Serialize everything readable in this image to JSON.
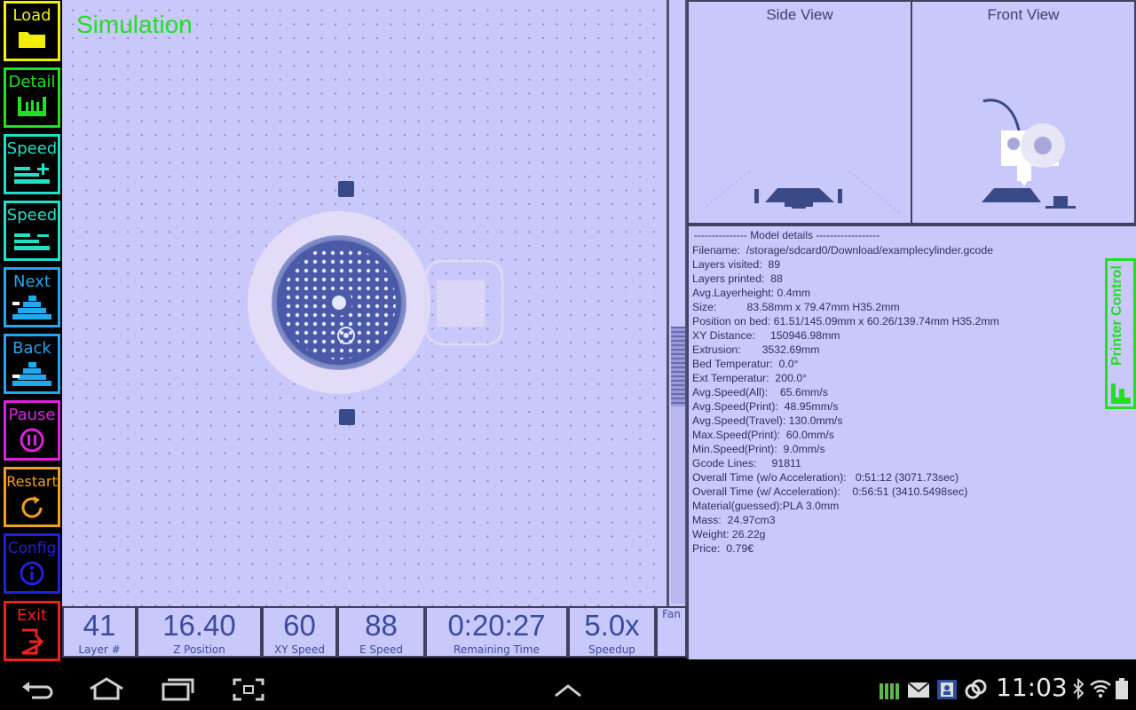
{
  "sidebar": {
    "buttons": [
      {
        "label": "Load",
        "color": "#f0f000",
        "icon": "folder-icon"
      },
      {
        "label": "Detail",
        "color": "#20e020",
        "icon": "detail-icon"
      },
      {
        "label": "Speed",
        "color": "#20e0c8",
        "icon": "speed-up-icon"
      },
      {
        "label": "Speed",
        "color": "#20e0c8",
        "icon": "speed-down-icon"
      },
      {
        "label": "Next",
        "color": "#20a8f0",
        "icon": "next-layer-icon"
      },
      {
        "label": "Back",
        "color": "#20a8f0",
        "icon": "back-layer-icon"
      },
      {
        "label": "Pause",
        "color": "#e020e0",
        "icon": "pause-icon"
      },
      {
        "label": "Restart",
        "color": "#f0a020",
        "icon": "restart-icon"
      },
      {
        "label": "Config",
        "color": "#2020e0",
        "icon": "info-icon"
      },
      {
        "label": "Exit",
        "color": "#f02020",
        "icon": "exit-icon"
      }
    ]
  },
  "canvas": {
    "title": "Simulation"
  },
  "stats": [
    {
      "value": "41",
      "label": "Layer #"
    },
    {
      "value": "16.40",
      "label": "Z Position"
    },
    {
      "value": "60",
      "label": "XY Speed"
    },
    {
      "value": "88",
      "label": "E Speed"
    },
    {
      "value": "0:20:27",
      "label": "Remaining Time"
    },
    {
      "value": "5.0x",
      "label": "Speedup"
    },
    {
      "value": "",
      "label": "Fan"
    }
  ],
  "views": {
    "side": "Side View",
    "front": "Front View"
  },
  "details": {
    "header": "--------------- Model details ------------------",
    "lines": [
      "Filename:  /storage/sdcard0/Download/examplecylinder.gcode",
      "Layers visited:  89",
      "Layers printed:  88",
      "Avg.Layerheight: 0.4mm",
      "Size:          83.58mm x 79.47mm H35.2mm",
      "Position on bed: 61.51/145.09mm x 60.26/139.74mm H35.2mm",
      "XY Distance:     150946.98mm",
      "Extrusion:       3532.69mm",
      "Bed Temperatur:  0.0°",
      "Ext Temperatur:  200.0°",
      "Avg.Speed(All):    65.6mm/s",
      "Avg.Speed(Print):  48.95mm/s",
      "Avg.Speed(Travel): 130.0mm/s",
      "Max.Speed(Print):  60.0mm/s",
      "Min.Speed(Print):  9.0mm/s",
      "Gcode Lines:     91811",
      "Overall Time (w/o Acceleration):   0:51:12 (3071.73sec)",
      "Overall Time (w/ Acceleration):    0:56:51 (3410.5498sec)",
      "Material(guessed):PLA 3.0mm",
      "Mass:  24.97cm3",
      "Weight: 26.22g",
      "Price:  0.79€"
    ]
  },
  "printer_control": "Printer Control",
  "status": {
    "clock": "11:03"
  },
  "layer_slider": {
    "progress": 0.46
  }
}
